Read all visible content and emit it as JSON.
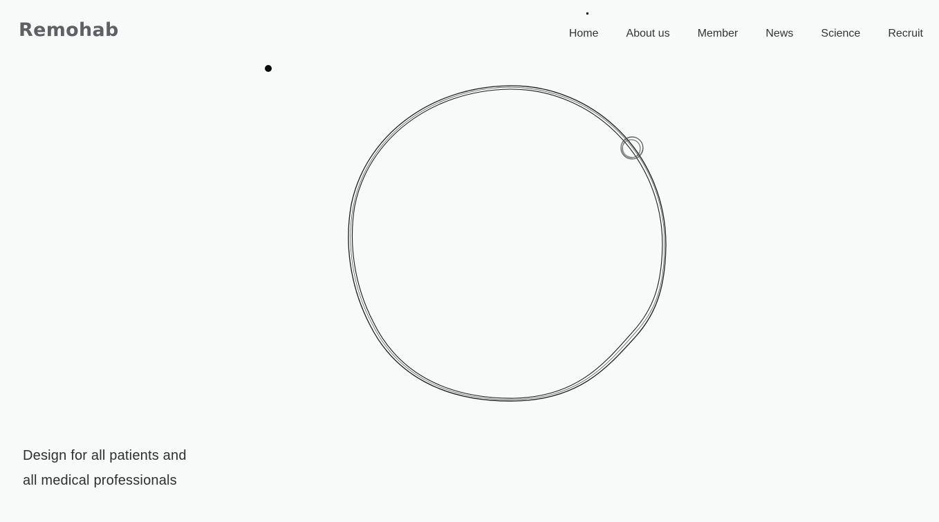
{
  "brand": {
    "name": "Remohab"
  },
  "nav": {
    "items": [
      {
        "label": "Home"
      },
      {
        "label": "About us"
      },
      {
        "label": "Member"
      },
      {
        "label": "News"
      },
      {
        "label": "Science"
      },
      {
        "label": "Recruit"
      }
    ]
  },
  "hero": {
    "tagline_line1": "Design for all patients and",
    "tagline_line2": "all medical professionals"
  },
  "colors": {
    "background": "#f8faf9",
    "logo": "#5f6063",
    "text": "#333333",
    "stroke": "#1a1a1a"
  }
}
